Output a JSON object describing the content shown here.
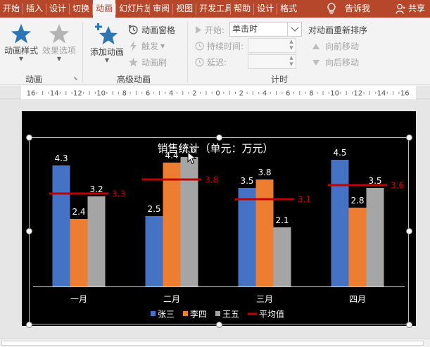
{
  "tabs": [
    {
      "label": "开始",
      "active": false
    },
    {
      "label": "插入",
      "active": false
    },
    {
      "label": "设计",
      "active": false
    },
    {
      "label": "切换",
      "active": false
    },
    {
      "label": "动画",
      "active": true
    },
    {
      "label": "幻灯片放映",
      "active": false
    },
    {
      "label": "审阅",
      "active": false
    },
    {
      "label": "视图",
      "active": false
    },
    {
      "label": "开发工具",
      "active": false
    },
    {
      "label": "帮助",
      "active": false
    },
    {
      "label": "设计",
      "active": false
    },
    {
      "label": "格式",
      "active": false
    }
  ],
  "tell_me": "告诉我",
  "share": "共享",
  "ribbon": {
    "animation_styles": "动画样式",
    "effect_options": "效果选项",
    "group_animation": "动画",
    "add_animation": "添加动画",
    "animation_pane": "动画窗格",
    "trigger": "触发",
    "animation_painter": "动画刷",
    "group_advanced": "高级动画",
    "start_label": "开始:",
    "start_value": "单击时",
    "duration_label": "持续时间:",
    "delay_label": "延迟:",
    "group_timing": "计时",
    "reorder_title": "对动画重新排序",
    "move_earlier": "向前移动",
    "move_later": "向后移动"
  },
  "ruler": {
    "labels": [
      "16",
      "14",
      "12",
      "10",
      "8",
      "6",
      "4",
      "2",
      "0",
      "2",
      "4",
      "6",
      "8",
      "10",
      "12",
      "14",
      "16"
    ]
  },
  "colors": {
    "accent": "#b7472a",
    "zhang": "#4472c4",
    "li": "#ed7d31",
    "wang": "#a5a5a5",
    "avg": "#c00000"
  },
  "chart_data": {
    "type": "bar",
    "title": "销售统计（单元：万元）",
    "categories": [
      "一月",
      "二月",
      "三月",
      "四月"
    ],
    "series": [
      {
        "name": "张三",
        "values": [
          4.3,
          2.5,
          3.5,
          4.5
        ],
        "color": "#4472c4"
      },
      {
        "name": "李四",
        "values": [
          2.4,
          4.4,
          3.8,
          2.8
        ],
        "color": "#ed7d31"
      },
      {
        "name": "王五",
        "values": [
          3.2,
          4.6,
          2.1,
          3.5
        ],
        "color": "#a5a5a5"
      }
    ],
    "average": {
      "name": "平均值",
      "values": [
        3.3,
        3.8,
        3.1,
        3.6
      ],
      "color": "#c00000"
    },
    "ylim": [
      0,
      5
    ],
    "grid": false,
    "legend": "bottom"
  }
}
